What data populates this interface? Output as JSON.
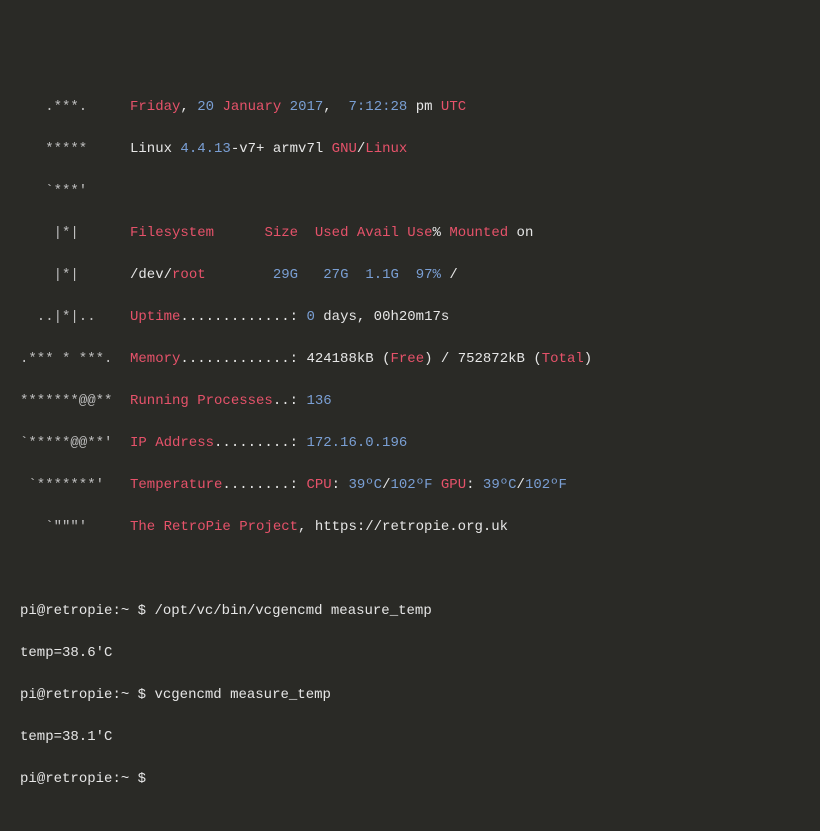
{
  "motd": {
    "logo": [
      "   .***.   ",
      "   *****   ",
      "   `***'   ",
      "    |*|    ",
      "    |*|    ",
      "  ..|*|..  ",
      ".*** * ***.",
      "*******@@**",
      "`*****@@**'",
      " `*******' ",
      "   `\"\"\"'   "
    ],
    "date": {
      "day": "Friday",
      "sep1": ", ",
      "dnum": "20",
      "month": " January ",
      "year": "2017",
      "sep2": ",  ",
      "time": "7:12:28",
      "ampm": " pm ",
      "tz": "UTC"
    },
    "os": {
      "kernel": "Linux ",
      "version": "4.4.13",
      "suffix": "-v7+ armv7l ",
      "gnu": "GNU",
      "slash": "/",
      "linux": "Linux"
    },
    "fs_header": {
      "label": "Filesystem",
      "size": "Size",
      "used": "Used",
      "avail": "Avail",
      "usepct": "Use",
      "pct": "%",
      "mounted": "Mounted",
      "on": " on"
    },
    "fs_row": {
      "dev": "/dev/",
      "root": "root",
      "size": "29G",
      "used": "27G",
      "avail": "1.1G",
      "usepct": "97%",
      "mount": "/"
    },
    "uptime": {
      "label": "Uptime",
      "dots": ".............: ",
      "days": "0",
      "rest": " days, 00h20m17s"
    },
    "memory": {
      "label": "Memory",
      "dots": ".............: ",
      "free_val": "424188kB",
      "lp1": " (",
      "free": "Free",
      "rp1": ") / ",
      "total_val": "752872kB",
      "lp2": " (",
      "total": "Total",
      "rp2": ")"
    },
    "procs": {
      "label": "Running Processes",
      "dots": "..: ",
      "val": "136"
    },
    "ip": {
      "label": "IP Address",
      "dots": ".........: ",
      "val": "172.16.0.196"
    },
    "temp": {
      "label": "Temperature",
      "dots": "........: ",
      "cpu": "CPU",
      "c1": ": ",
      "cpu_c": "39ºC",
      "s1": "/",
      "cpu_f": "102ºF",
      "gpu": " GPU",
      "c2": ": ",
      "gpu_c": "39ºC",
      "s2": "/",
      "gpu_f": "102ºF"
    },
    "project": {
      "name": "The RetroPie Project",
      "sep": ", ",
      "url": "https://retropie.org.uk"
    }
  },
  "shell": {
    "user": "pi",
    "at": "@",
    "host": "retropie",
    "path": ":~",
    "dollar": " $ ",
    "cmd1": "/opt/vc/bin/vcgencmd measure_temp",
    "out1": "temp=38.6'C",
    "cmd2": "vcgencmd measure_temp",
    "out2": "temp=38.1'C"
  }
}
